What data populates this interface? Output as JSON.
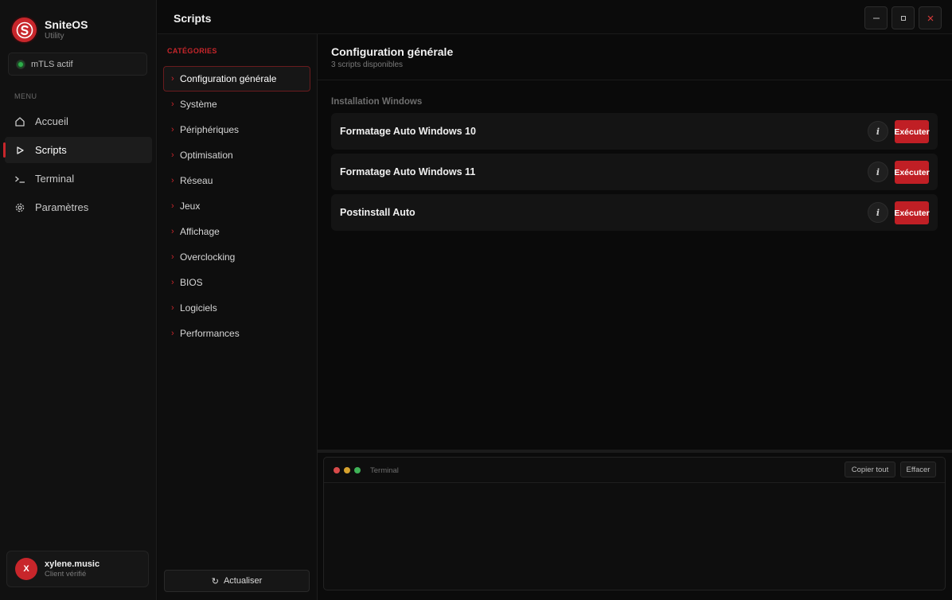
{
  "app": {
    "name": "SniteOS",
    "subtitle": "Utility",
    "brand_color": "#c8262b"
  },
  "connection": {
    "label": "mTLS actif",
    "status_color": "#2eae4a"
  },
  "sidebar": {
    "menu_caption": "MENU",
    "items": [
      {
        "label": "Accueil",
        "icon": "home-icon",
        "active": false
      },
      {
        "label": "Scripts",
        "icon": "play-icon",
        "active": true
      },
      {
        "label": "Terminal",
        "icon": "terminal-icon",
        "active": false
      },
      {
        "label": "Paramètres",
        "icon": "gear-icon",
        "active": false
      }
    ]
  },
  "user": {
    "initial": "X",
    "name": "xylene.music",
    "status": "Client vérifié"
  },
  "titlebar": {
    "title": "Scripts",
    "minimize_icon": "minimize-icon",
    "maximize_icon": "maximize-icon",
    "close_icon": "close-icon"
  },
  "categories": {
    "caption": "CATÉGORIES",
    "items": [
      {
        "label": "Configuration générale",
        "active": true
      },
      {
        "label": "Système",
        "active": false
      },
      {
        "label": "Périphériques",
        "active": false
      },
      {
        "label": "Optimisation",
        "active": false
      },
      {
        "label": "Réseau",
        "active": false
      },
      {
        "label": "Jeux",
        "active": false
      },
      {
        "label": "Affichage",
        "active": false
      },
      {
        "label": "Overclocking",
        "active": false
      },
      {
        "label": "BIOS",
        "active": false
      },
      {
        "label": "Logiciels",
        "active": false
      },
      {
        "label": "Performances",
        "active": false
      }
    ],
    "refresh_label": "Actualiser",
    "refresh_icon": "refresh-icon"
  },
  "main": {
    "title": "Configuration générale",
    "subtitle": "3 scripts disponibles",
    "group_title": "Installation Windows",
    "scripts": [
      {
        "name": "Formatage Auto Windows 10",
        "info_glyph": "i",
        "run_label": "Exécuter"
      },
      {
        "name": "Formatage Auto Windows 11",
        "info_glyph": "i",
        "run_label": "Exécuter"
      },
      {
        "name": "Postinstall Auto",
        "info_glyph": "i",
        "run_label": "Exécuter"
      }
    ]
  },
  "terminal": {
    "title": "Terminal",
    "copy_label": "Copier tout",
    "clear_label": "Effacer",
    "output": ""
  }
}
